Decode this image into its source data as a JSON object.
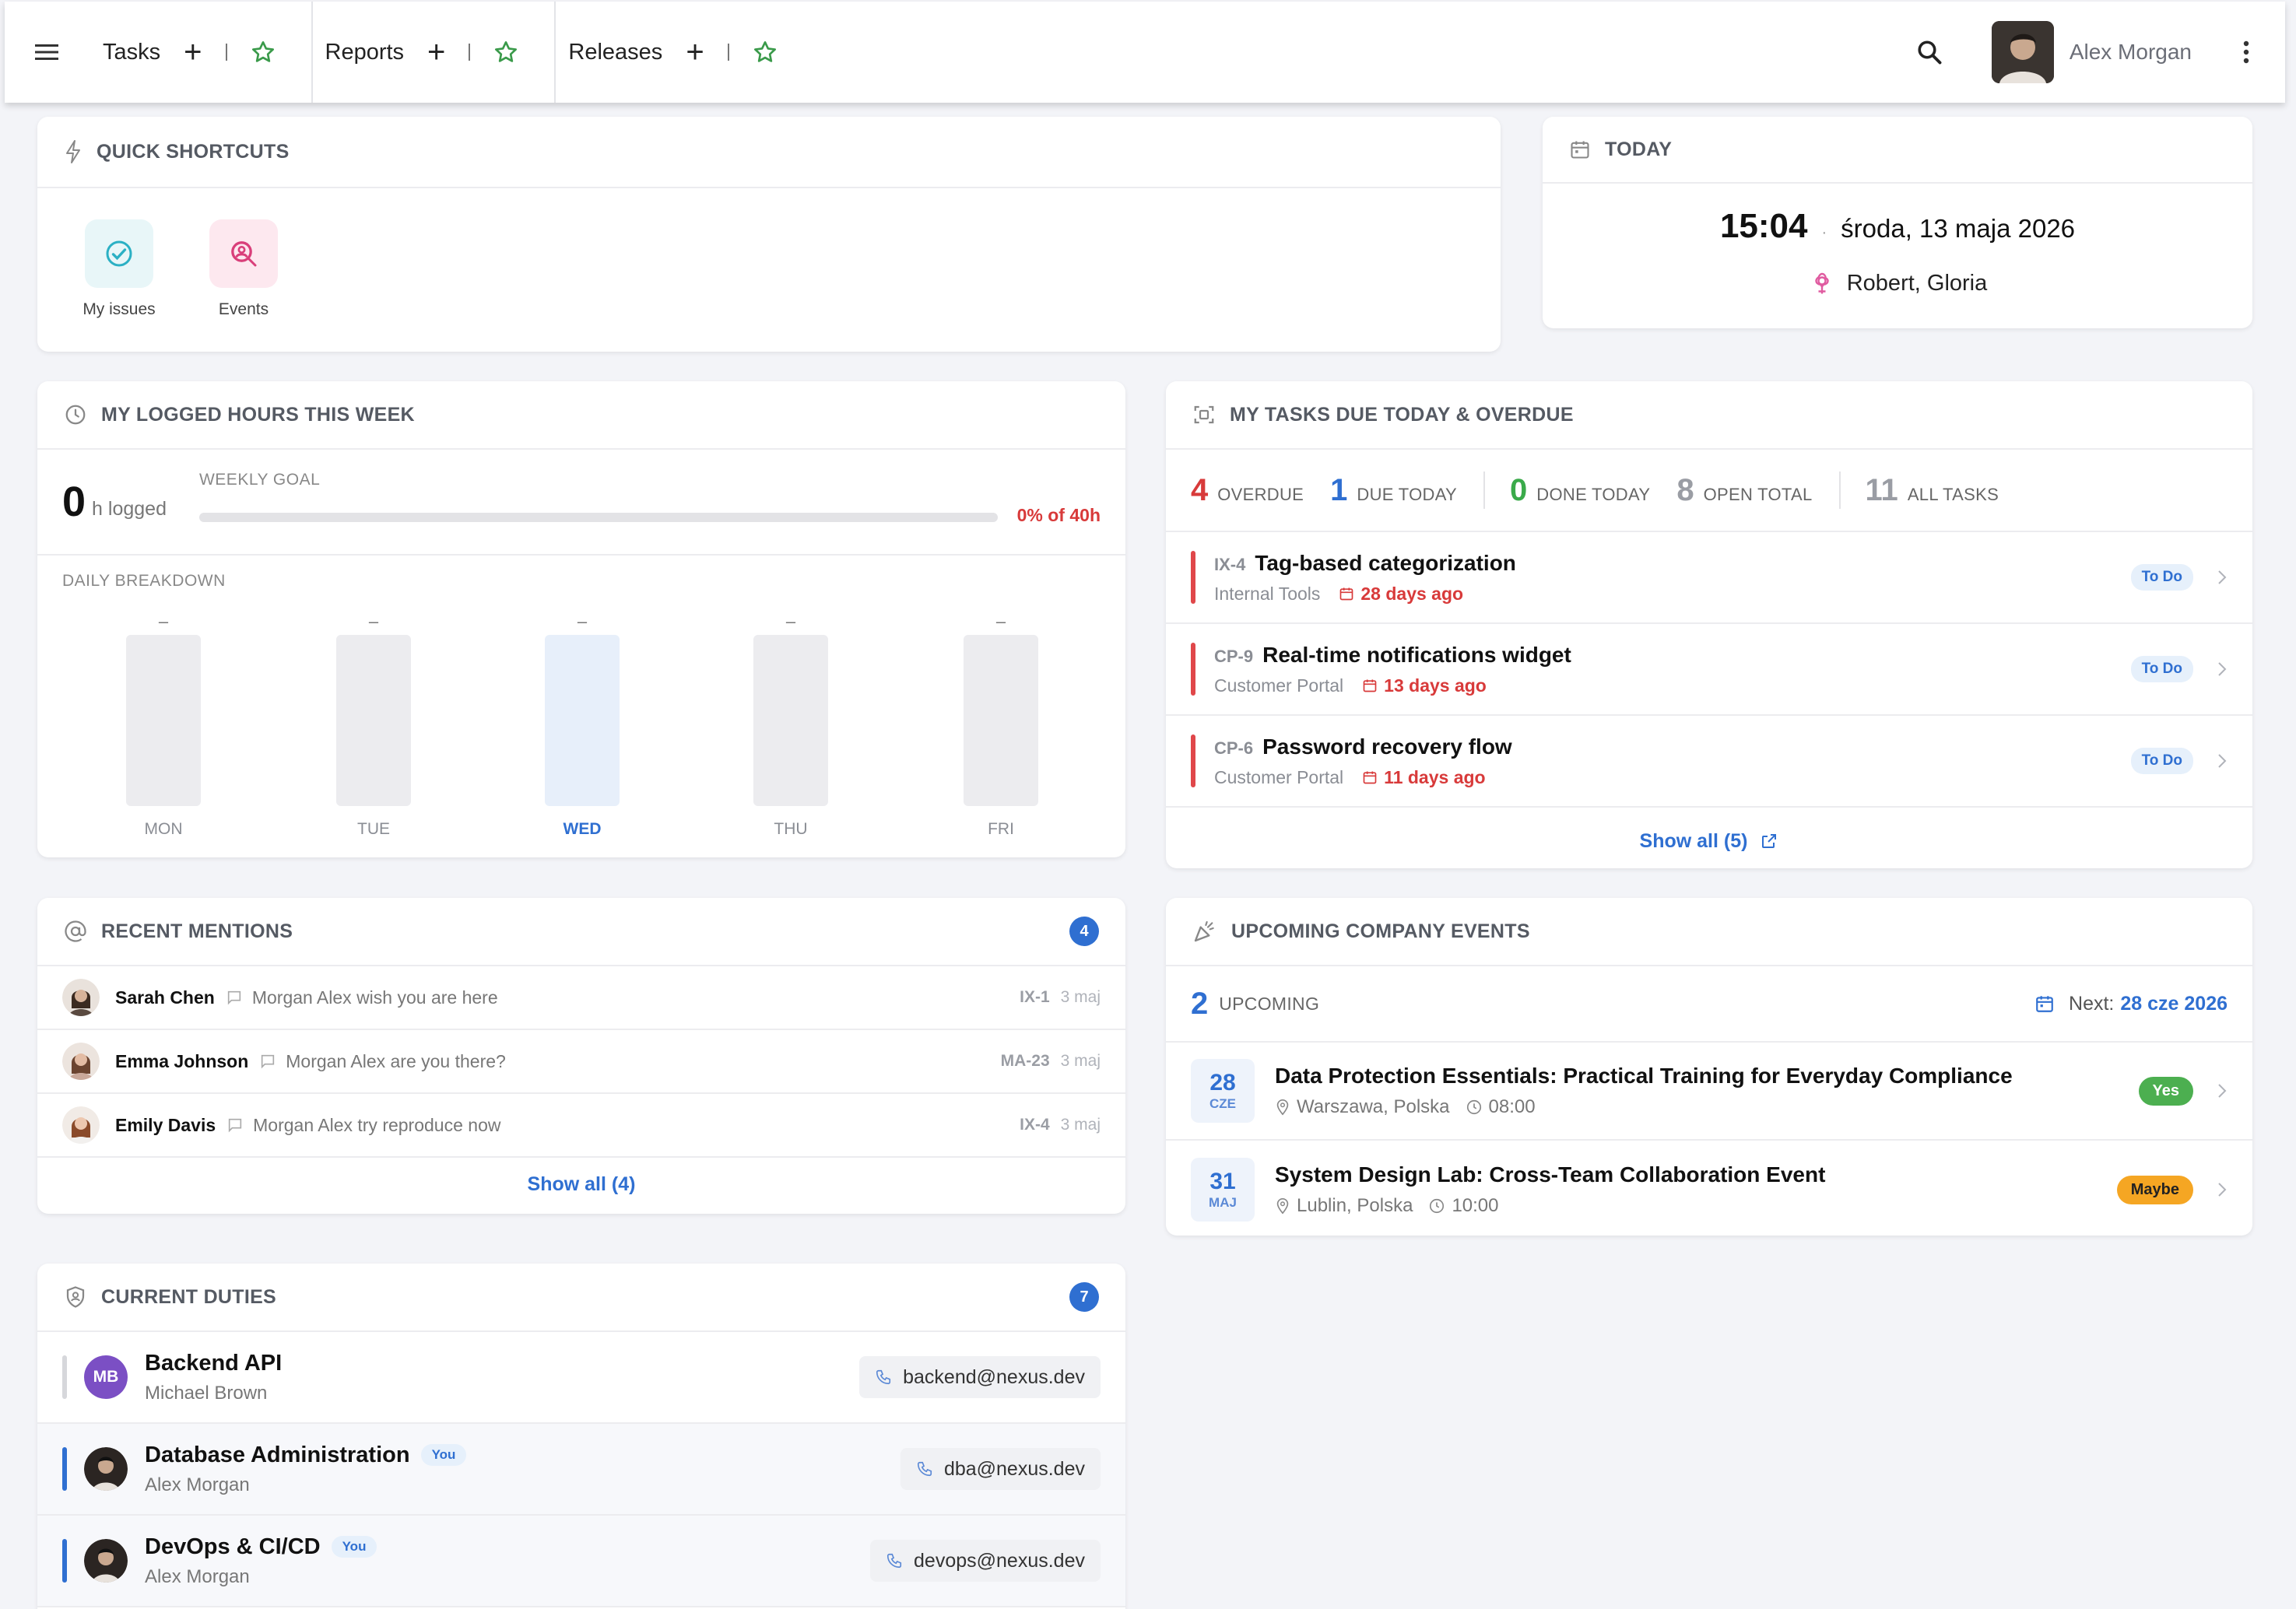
{
  "topbar": {
    "tabs": [
      {
        "label": "Tasks"
      },
      {
        "label": "Reports"
      },
      {
        "label": "Releases"
      }
    ],
    "user_name": "Alex Morgan"
  },
  "shortcuts": {
    "title": "QUICK SHORTCUTS",
    "items": [
      {
        "label": "My issues",
        "icon": "check-circle-icon",
        "color": "#e8f6f8"
      },
      {
        "label": "Events",
        "icon": "event-search-icon",
        "color": "#fde8ef"
      }
    ]
  },
  "today": {
    "title": "TODAY",
    "time": "15:04",
    "separator": "·",
    "date": "środa, 13 maja 2026",
    "names": "Robert, Gloria"
  },
  "hours": {
    "title": "MY LOGGED HOURS THIS WEEK",
    "logged": "0",
    "unit": "h logged",
    "goal_label": "WEEKLY GOAL",
    "goal_pct": "0% of 40h",
    "goal_fraction": 0,
    "breakdown_label": "DAILY BREAKDOWN",
    "days": [
      {
        "day": "MON",
        "value": "–",
        "active": false
      },
      {
        "day": "TUE",
        "value": "–",
        "active": false
      },
      {
        "day": "WED",
        "value": "–",
        "active": true
      },
      {
        "day": "THU",
        "value": "–",
        "active": false
      },
      {
        "day": "FRI",
        "value": "–",
        "active": false
      }
    ]
  },
  "tasks": {
    "title": "MY TASKS DUE TODAY & OVERDUE",
    "stats": [
      {
        "num": "4",
        "label": "OVERDUE",
        "color": "#d83a3a"
      },
      {
        "num": "1",
        "label": "DUE TODAY",
        "color": "#2f6fd1"
      },
      {
        "num": "0",
        "label": "DONE TODAY",
        "color": "#3aaa4a"
      },
      {
        "num": "8",
        "label": "OPEN TOTAL",
        "color": "#9a9da4"
      },
      {
        "num": "11",
        "label": "ALL TASKS",
        "color": "#9a9da4"
      }
    ],
    "items": [
      {
        "key": "IX-4",
        "title": "Tag-based categorization",
        "project": "Internal Tools",
        "due": "28 days ago",
        "status": "To Do"
      },
      {
        "key": "CP-9",
        "title": "Real-time notifications widget",
        "project": "Customer Portal",
        "due": "13 days ago",
        "status": "To Do"
      },
      {
        "key": "CP-6",
        "title": "Password recovery flow",
        "project": "Customer Portal",
        "due": "11 days ago",
        "status": "To Do"
      }
    ],
    "show_all": "Show all (5)"
  },
  "mentions": {
    "title": "RECENT MENTIONS",
    "count": "4",
    "items": [
      {
        "name": "Sarah Chen",
        "text": "Morgan Alex wish you are here",
        "ref": "IX-1",
        "date": "3 maj"
      },
      {
        "name": "Emma Johnson",
        "text": "Morgan Alex are you there?",
        "ref": "MA-23",
        "date": "3 maj"
      },
      {
        "name": "Emily Davis",
        "text": "Morgan Alex try reproduce now",
        "ref": "IX-4",
        "date": "3 maj"
      }
    ],
    "show_all": "Show all (4)"
  },
  "events": {
    "title": "UPCOMING COMPANY EVENTS",
    "count": "2",
    "count_label": "UPCOMING",
    "next_label": "Next:",
    "next_date": "28 cze 2026",
    "items": [
      {
        "day": "28",
        "month": "CZE",
        "title": "Data Protection Essentials: Practical Training for Everyday Compliance",
        "location": "Warszawa, Polska",
        "time": "08:00",
        "rsvp": "Yes",
        "rsvp_bg": "#4caf50",
        "rsvp_fg": "#ffffff"
      },
      {
        "day": "31",
        "month": "MAJ",
        "title": "System Design Lab: Cross-Team Collaboration Event",
        "location": "Lublin, Polska",
        "time": "10:00",
        "rsvp": "Maybe",
        "rsvp_bg": "#f5a623",
        "rsvp_fg": "#222222"
      }
    ]
  },
  "duties": {
    "title": "CURRENT DUTIES",
    "count": "7",
    "items": [
      {
        "name": "Backend API",
        "person": "Michael Brown",
        "initials": "MB",
        "contact": "backend@nexus.dev",
        "you": ""
      },
      {
        "name": "Database Administration",
        "person": "Alex Morgan",
        "initials": "",
        "contact": "dba@nexus.dev",
        "you": "You"
      },
      {
        "name": "DevOps & CI/CD",
        "person": "Alex Morgan",
        "initials": "",
        "contact": "devops@nexus.dev",
        "you": "You"
      }
    ]
  }
}
